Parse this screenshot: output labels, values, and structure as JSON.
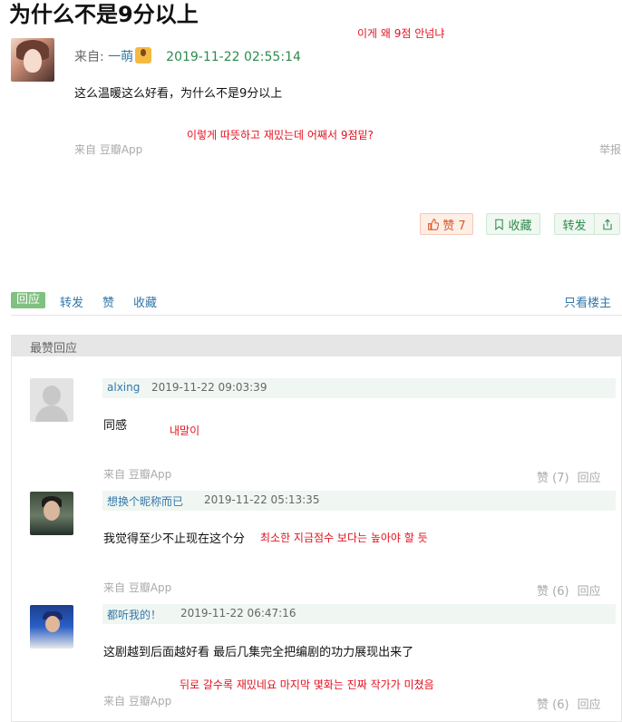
{
  "post": {
    "title": "为什么不是9分以上",
    "from_label": "来自:",
    "author": "一萌",
    "emoji_icon": "person-raising-hand-emoji",
    "date": "2019-11-22 02:55:14",
    "body": "这么温暖这么好看，为什么不是9分以上",
    "source": "来自 豆瓣App",
    "report": "举报",
    "like_label": "赞 7",
    "collect_label": "收藏",
    "repost_label": "转发"
  },
  "annotations": {
    "title_ko": "이게 왜 9점 안넘냐",
    "body_ko": "이렇게 따뜻하고 재밌는데 어째서 9점밑?",
    "c1_ko": "내말이",
    "c2_ko": "최소한 지금점수 보다는 높아야 할 듯",
    "c3_ko": "뒤로 갈수록 재밌네요 마지막 몇화는 진짜 작가가 미쳤음"
  },
  "tabs": {
    "reply": "回应",
    "repost": "转发",
    "like": "赞",
    "collect": "收藏",
    "op_only": "只看楼主"
  },
  "best_replies": {
    "header": "最赞回应",
    "comments": [
      {
        "user": "alxing",
        "time": "2019-11-22 09:03:39",
        "text": "同感",
        "source": "来自 豆瓣App",
        "likes": "赞 (7)",
        "reply": "回应"
      },
      {
        "user": "想换个昵称而已",
        "time": "2019-11-22 05:13:35",
        "text": "我觉得至少不止现在这个分",
        "source": "来自 豆瓣App",
        "likes": "赞 (6)",
        "reply": "回应"
      },
      {
        "user": "都听我的！",
        "time": "2019-11-22 06:47:16",
        "text": "这剧越到后面越好看 最后几集完全把编剧的功力展现出来了",
        "source": "来自 豆瓣App",
        "likes": "赞 (6)",
        "reply": "回应"
      }
    ]
  },
  "colors": {
    "link": "#3377aa",
    "date_green": "#2e8a4d",
    "annotation_red": "#e4111f",
    "active_tab": "#7fc17f"
  }
}
